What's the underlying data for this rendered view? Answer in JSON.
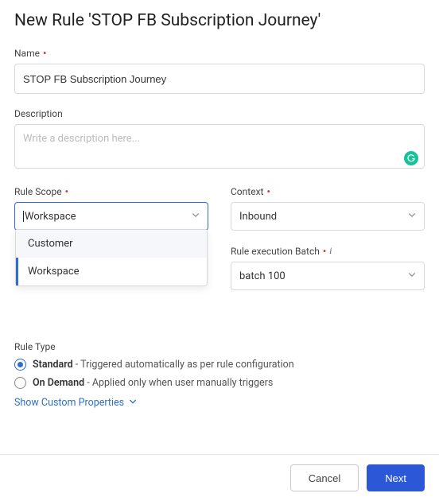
{
  "title": "New Rule 'STOP FB Subscription Journey'",
  "fields": {
    "name": {
      "label": "Name",
      "value": "STOP FB Subscription Journey"
    },
    "description": {
      "label": "Description",
      "placeholder": "Write a description here..."
    },
    "ruleScope": {
      "label": "Rule Scope",
      "value": "Workspace",
      "options": [
        "Customer",
        "Workspace"
      ],
      "selectedIndex": 1
    },
    "context": {
      "label": "Context",
      "value": "Inbound"
    },
    "batch": {
      "label": "Rule execution Batch",
      "value": "batch 100"
    }
  },
  "ruleType": {
    "label": "Rule Type",
    "selected": "standard",
    "standard": {
      "name": "Standard",
      "desc": " - Triggered automatically as per rule configuration"
    },
    "ondemand": {
      "name": "On Demand",
      "desc": " - Applied only when user manually triggers"
    }
  },
  "customProps": {
    "label": "Show Custom Properties"
  },
  "footer": {
    "cancel": "Cancel",
    "next": "Next"
  }
}
